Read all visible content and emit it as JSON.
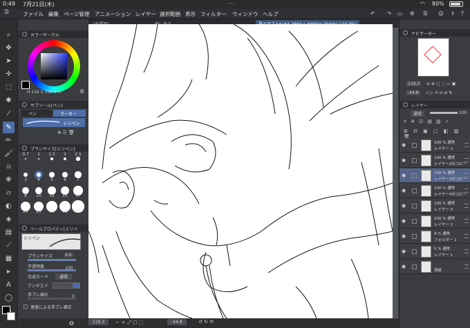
{
  "status": {
    "time": "0:49",
    "date": "7月21日(木)",
    "battery": "80%",
    "more": "···"
  },
  "menu": [
    "ファイル",
    "編集",
    "ページ管理",
    "アニメーション",
    "レイヤー",
    "選択範囲",
    "表示",
    "フィルター",
    "ウィンドウ",
    "ヘルプ"
  ],
  "doc_tabs": [
    {
      "label": "Of(運用)",
      "active": false
    },
    {
      "label": "相し描き",
      "active": false
    },
    {
      "label": "夏イラスト* (A4 2894 x 4093px 350dpi 119.3%)",
      "active": true
    }
  ],
  "left": {
    "color_circle": {
      "title": "カラーサークル",
      "h": "216",
      "s": "100",
      "v": "0"
    },
    "subtool": {
      "title": "サブツール[ペン]",
      "tab_pen": "ペン",
      "tab_marker": "マーカー",
      "brush_name": "ミリペン"
    },
    "brush_size": {
      "title": "ブラシサイズ[ミリペン]",
      "sizes": [
        "0.7",
        "1",
        "1.5",
        "2",
        "2.5",
        "3",
        "4",
        "5",
        "6",
        "7",
        "8",
        "10",
        "12",
        "15",
        "17",
        "20",
        "25",
        "30",
        "40",
        "50"
      ]
    },
    "tool_property": {
      "title": "ツールプロパティ[ミリペ",
      "preset": "ミリペン",
      "brush_size_label": "ブラシサイズ",
      "brush_size_value": "4.0",
      "opacity_label": "不透明度",
      "opacity_value": "100",
      "blend_label": "合成モード",
      "blend_value": "通常",
      "antialias_label": "アンチエイ",
      "correction_label": "手ブレ補正",
      "correction_value": "0",
      "speed_label": "速度による手ブレ補正"
    }
  },
  "bottom": {
    "zoom": "119.3",
    "rotation": "-44.8"
  },
  "right": {
    "navigator": {
      "title": "ナビゲーター",
      "zoom": "119.3",
      "angle": "-44.8"
    },
    "layer_panel": {
      "title": "レイヤー",
      "blend": "通常",
      "opacity": "100"
    },
    "layers": [
      {
        "pct": "100 %",
        "mode": "通常",
        "name": "レイヤー 3",
        "selected": false
      },
      {
        "pct": "100 %",
        "mode": "通常",
        "name": "レイヤー2のコピー",
        "selected": false
      },
      {
        "pct": "100 %",
        "mode": "通常",
        "name": "レイヤー2のコピー",
        "selected": true
      },
      {
        "pct": "100 %",
        "mode": "通常",
        "name": "レイヤー4のコピー",
        "selected": false
      },
      {
        "pct": "100 %",
        "mode": "通常",
        "name": "レイヤー 4",
        "selected": false
      },
      {
        "pct": "100 %",
        "mode": "通常",
        "name": "レイヤー 2",
        "selected": false
      },
      {
        "pct": "8 %",
        "mode": "通常",
        "name": "フォルダー 1",
        "selected": false
      },
      {
        "pct": "5 %",
        "mode": "通常",
        "name": "レイヤー 1",
        "selected": false
      },
      {
        "pct": "",
        "mode": "",
        "name": "用紙",
        "selected": false
      }
    ]
  },
  "colors": {
    "accent": "#4e6ea8",
    "selected_layer": "#55648a",
    "panel": "#3a3c3f",
    "toolbar": "#2d2e30"
  }
}
